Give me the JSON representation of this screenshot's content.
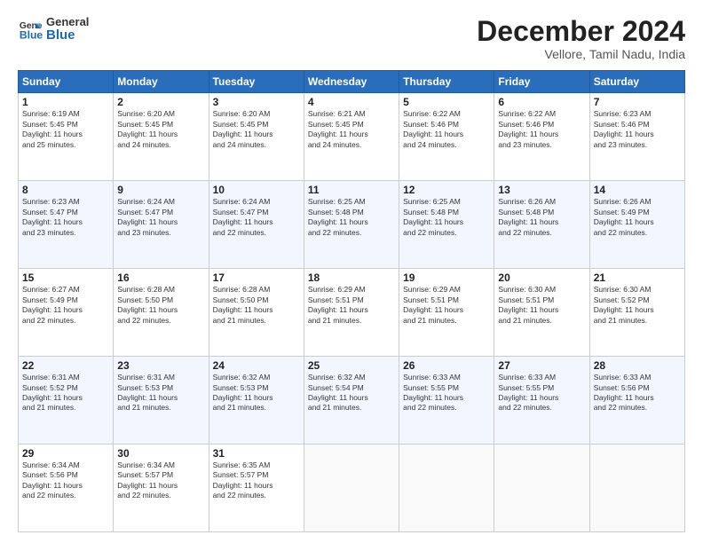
{
  "header": {
    "logo_general": "General",
    "logo_blue": "Blue",
    "month": "December 2024",
    "location": "Vellore, Tamil Nadu, India"
  },
  "days_of_week": [
    "Sunday",
    "Monday",
    "Tuesday",
    "Wednesday",
    "Thursday",
    "Friday",
    "Saturday"
  ],
  "weeks": [
    [
      {
        "day": "1",
        "info": "Sunrise: 6:19 AM\nSunset: 5:45 PM\nDaylight: 11 hours\nand 25 minutes."
      },
      {
        "day": "2",
        "info": "Sunrise: 6:20 AM\nSunset: 5:45 PM\nDaylight: 11 hours\nand 24 minutes."
      },
      {
        "day": "3",
        "info": "Sunrise: 6:20 AM\nSunset: 5:45 PM\nDaylight: 11 hours\nand 24 minutes."
      },
      {
        "day": "4",
        "info": "Sunrise: 6:21 AM\nSunset: 5:45 PM\nDaylight: 11 hours\nand 24 minutes."
      },
      {
        "day": "5",
        "info": "Sunrise: 6:22 AM\nSunset: 5:46 PM\nDaylight: 11 hours\nand 24 minutes."
      },
      {
        "day": "6",
        "info": "Sunrise: 6:22 AM\nSunset: 5:46 PM\nDaylight: 11 hours\nand 23 minutes."
      },
      {
        "day": "7",
        "info": "Sunrise: 6:23 AM\nSunset: 5:46 PM\nDaylight: 11 hours\nand 23 minutes."
      }
    ],
    [
      {
        "day": "8",
        "info": "Sunrise: 6:23 AM\nSunset: 5:47 PM\nDaylight: 11 hours\nand 23 minutes."
      },
      {
        "day": "9",
        "info": "Sunrise: 6:24 AM\nSunset: 5:47 PM\nDaylight: 11 hours\nand 23 minutes."
      },
      {
        "day": "10",
        "info": "Sunrise: 6:24 AM\nSunset: 5:47 PM\nDaylight: 11 hours\nand 22 minutes."
      },
      {
        "day": "11",
        "info": "Sunrise: 6:25 AM\nSunset: 5:48 PM\nDaylight: 11 hours\nand 22 minutes."
      },
      {
        "day": "12",
        "info": "Sunrise: 6:25 AM\nSunset: 5:48 PM\nDaylight: 11 hours\nand 22 minutes."
      },
      {
        "day": "13",
        "info": "Sunrise: 6:26 AM\nSunset: 5:48 PM\nDaylight: 11 hours\nand 22 minutes."
      },
      {
        "day": "14",
        "info": "Sunrise: 6:26 AM\nSunset: 5:49 PM\nDaylight: 11 hours\nand 22 minutes."
      }
    ],
    [
      {
        "day": "15",
        "info": "Sunrise: 6:27 AM\nSunset: 5:49 PM\nDaylight: 11 hours\nand 22 minutes."
      },
      {
        "day": "16",
        "info": "Sunrise: 6:28 AM\nSunset: 5:50 PM\nDaylight: 11 hours\nand 22 minutes."
      },
      {
        "day": "17",
        "info": "Sunrise: 6:28 AM\nSunset: 5:50 PM\nDaylight: 11 hours\nand 21 minutes."
      },
      {
        "day": "18",
        "info": "Sunrise: 6:29 AM\nSunset: 5:51 PM\nDaylight: 11 hours\nand 21 minutes."
      },
      {
        "day": "19",
        "info": "Sunrise: 6:29 AM\nSunset: 5:51 PM\nDaylight: 11 hours\nand 21 minutes."
      },
      {
        "day": "20",
        "info": "Sunrise: 6:30 AM\nSunset: 5:51 PM\nDaylight: 11 hours\nand 21 minutes."
      },
      {
        "day": "21",
        "info": "Sunrise: 6:30 AM\nSunset: 5:52 PM\nDaylight: 11 hours\nand 21 minutes."
      }
    ],
    [
      {
        "day": "22",
        "info": "Sunrise: 6:31 AM\nSunset: 5:52 PM\nDaylight: 11 hours\nand 21 minutes."
      },
      {
        "day": "23",
        "info": "Sunrise: 6:31 AM\nSunset: 5:53 PM\nDaylight: 11 hours\nand 21 minutes."
      },
      {
        "day": "24",
        "info": "Sunrise: 6:32 AM\nSunset: 5:53 PM\nDaylight: 11 hours\nand 21 minutes."
      },
      {
        "day": "25",
        "info": "Sunrise: 6:32 AM\nSunset: 5:54 PM\nDaylight: 11 hours\nand 21 minutes."
      },
      {
        "day": "26",
        "info": "Sunrise: 6:33 AM\nSunset: 5:55 PM\nDaylight: 11 hours\nand 22 minutes."
      },
      {
        "day": "27",
        "info": "Sunrise: 6:33 AM\nSunset: 5:55 PM\nDaylight: 11 hours\nand 22 minutes."
      },
      {
        "day": "28",
        "info": "Sunrise: 6:33 AM\nSunset: 5:56 PM\nDaylight: 11 hours\nand 22 minutes."
      }
    ],
    [
      {
        "day": "29",
        "info": "Sunrise: 6:34 AM\nSunset: 5:56 PM\nDaylight: 11 hours\nand 22 minutes."
      },
      {
        "day": "30",
        "info": "Sunrise: 6:34 AM\nSunset: 5:57 PM\nDaylight: 11 hours\nand 22 minutes."
      },
      {
        "day": "31",
        "info": "Sunrise: 6:35 AM\nSunset: 5:57 PM\nDaylight: 11 hours\nand 22 minutes."
      },
      null,
      null,
      null,
      null
    ]
  ]
}
